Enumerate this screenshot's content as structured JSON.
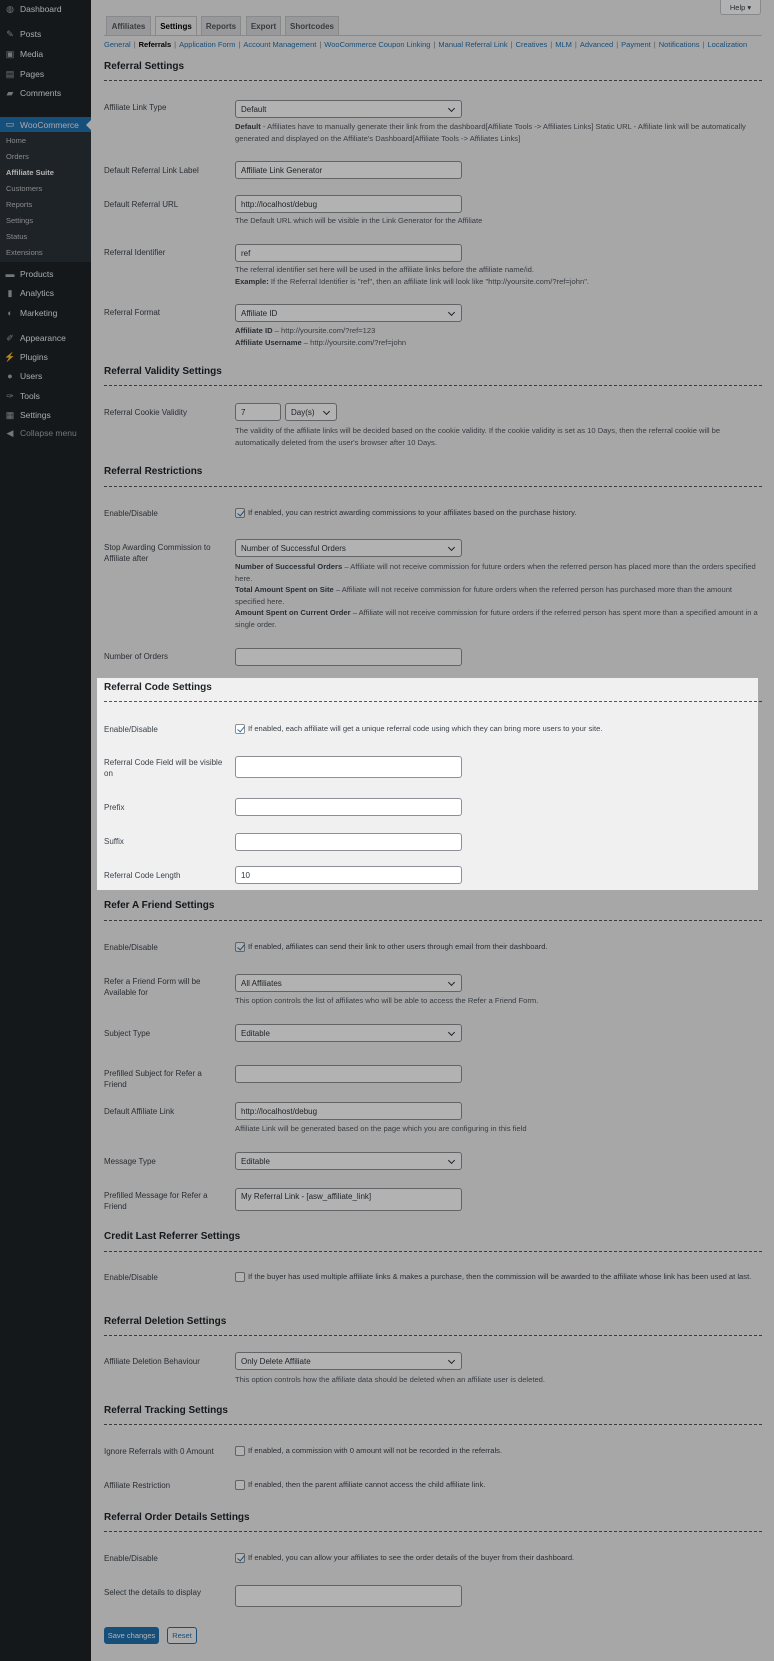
{
  "sidebar": {
    "items": [
      {
        "label": "Dashboard",
        "icon": "dashboard-icon"
      },
      {
        "label": "Posts",
        "icon": "pin-icon"
      },
      {
        "label": "Media",
        "icon": "media-icon"
      },
      {
        "label": "Pages",
        "icon": "pages-icon"
      },
      {
        "label": "Comments",
        "icon": "comment-icon"
      },
      {
        "label": "WooCommerce",
        "icon": "woo-icon"
      },
      {
        "label": "Products",
        "icon": "products-icon"
      },
      {
        "label": "Analytics",
        "icon": "analytics-icon"
      },
      {
        "label": "Marketing",
        "icon": "megaphone-icon"
      },
      {
        "label": "Appearance",
        "icon": "brush-icon"
      },
      {
        "label": "Plugins",
        "icon": "plug-icon"
      },
      {
        "label": "Users",
        "icon": "user-icon"
      },
      {
        "label": "Tools",
        "icon": "wrench-icon"
      },
      {
        "label": "Settings",
        "icon": "settings-icon"
      },
      {
        "label": "Collapse menu",
        "icon": "collapse-icon"
      }
    ],
    "submenu": [
      "Home",
      "Orders",
      "Affiliate Suite",
      "Customers",
      "Reports",
      "Settings",
      "Status",
      "Extensions"
    ]
  },
  "help": "Help ▾",
  "tabs": [
    "Affiliates",
    "Settings",
    "Reports",
    "Export",
    "Shortcodes"
  ],
  "subnav": [
    "General",
    "Referrals",
    "Application Form",
    "Account Management",
    "WooCommerce Coupon Linking",
    "Manual Referral Link",
    "Creatives",
    "MLM",
    "Advanced",
    "Payment",
    "Notifications",
    "Localization"
  ],
  "s0": {
    "title": "Referral Settings",
    "link_type": {
      "label": "Affiliate Link Type",
      "value": "Default",
      "desc_b": "Default",
      "desc": " - Affiliates have to manually generate their link from the dashboard[Affiliate Tools -> Affiliates Links] Static URL - Affiliate link will be automatically generated and displayed on the Affiliate's Dashboard[Affiliate Tools -> Affiliates Links]"
    },
    "link_label": {
      "label": "Default Referral Link Label",
      "value": "Affiliate Link Generator"
    },
    "url": {
      "label": "Default Referral URL",
      "value": "http://localhost/debug",
      "desc": "The Default URL which will be visible in the Link Generator for the Affiliate"
    },
    "identifier": {
      "label": "Referral Identifier",
      "value": "ref",
      "desc": "The referral identifier set here will be used in the affiliate links before the affiliate name/id.",
      "ex_b": "Example:",
      "ex": " If the Referral Identifier is \"ref\", then an affiliate link will look like \"http://yoursite.com/?ref=john\"."
    },
    "format": {
      "label": "Referral Format",
      "value": "Affiliate ID",
      "l1b": "Affiliate ID",
      "l1": " – http://yoursite.com/?ref=123",
      "l2b": "Affiliate Username",
      "l2": " – http://yoursite.com/?ref=john"
    }
  },
  "s1": {
    "title": "Referral Validity Settings",
    "label": "Referral Cookie Validity",
    "value": "7",
    "unit": "Day(s)",
    "desc": "The validity of the affiliate links will be decided based on the cookie validity. If the cookie validity is set as 10 Days, then the referral cookie will be automatically deleted from the user's browser after 10 Days."
  },
  "s2": {
    "title": "Referral Restrictions",
    "enable_label": "Enable/Disable",
    "enable_text": "If enabled, you can restrict awarding commissions to your affiliates based on the purchase history.",
    "enabled": true,
    "stop_label": "Stop Awarding Commission to Affiliate after",
    "stop_value": "Number of Successful Orders",
    "d1b": "Number of Successful Orders",
    "d1": " – Affiliate will not receive commission for future orders when the referred person has placed more than the orders specified here.",
    "d2b": "Total Amount Spent on Site",
    "d2": " – Affiliate will not receive commission for future orders when the referred person has purchased more than the amount specified here.",
    "d3b": "Amount Spent on Current Order",
    "d3": " – Affiliate will not receive commission for future orders if the referred person has spent more than a specified amount in a single order.",
    "orders_label": "Number of Orders",
    "orders_value": ""
  },
  "s3": {
    "title": "Referral Code Settings",
    "enable_label": "Enable/Disable",
    "enable_text": "If enabled, each affiliate will get a unique referral code using which they can bring more users to your site.",
    "enabled": true,
    "visible_label": "Referral Code Field will be visible on",
    "prefix_label": "Prefix",
    "suffix_label": "Suffix",
    "length_label": "Referral Code Length",
    "length_value": "10"
  },
  "s4": {
    "title": "Refer A Friend Settings",
    "enable_label": "Enable/Disable",
    "enable_text": "If enabled, affiliates can send their link to other users through email from their dashboard.",
    "enabled": true,
    "form_label": "Refer a Friend Form will be Available for",
    "form_value": "All Affiliates",
    "form_desc": "This option controls the list of affiliates who will be able to access the Refer a Friend Form.",
    "subject_type_label": "Subject Type",
    "subject_type_value": "Editable",
    "subject_label": "Prefilled Subject for Refer a Friend",
    "link_label": "Default Affiliate Link",
    "link_value": "http://localhost/debug",
    "link_desc": "Affiliate Link will be generated based on the page which you are configuring in this field",
    "msg_type_label": "Message Type",
    "msg_type_value": "Editable",
    "msg_label": "Prefilled Message for Refer a Friend",
    "msg_value": "My Referral Link - [asw_affiliate_link]"
  },
  "s5": {
    "title": "Credit Last Referrer Settings",
    "enable_label": "Enable/Disable",
    "enable_text": "If the buyer has used multiple affiliate links & makes a purchase, then the commission will be awarded to the affiliate whose link has been used at last.",
    "enabled": false
  },
  "s6": {
    "title": "Referral Deletion Settings",
    "label": "Affiliate Deletion Behaviour",
    "value": "Only Delete Affiliate",
    "desc": "This option controls how the affiliate data should be deleted when an affiliate user is deleted."
  },
  "s7": {
    "title": "Referral Tracking Settings",
    "ignore_label": "Ignore Referrals with 0 Amount",
    "ignore_text": "If enabled, a commission with 0 amount will not be recorded in the referrals.",
    "restrict_label": "Affiliate Restriction",
    "restrict_text": "If enabled, then the parent affiliate cannot access the child affiliate link."
  },
  "s8": {
    "title": "Referral Order Details Settings",
    "enable_label": "Enable/Disable",
    "enable_text": "If enabled, you can allow your affiliates to see the order details of the buyer from their dashboard.",
    "enabled": true,
    "details_label": "Select the details to display"
  },
  "buttons": {
    "save": "Save changes",
    "reset": "Reset"
  }
}
